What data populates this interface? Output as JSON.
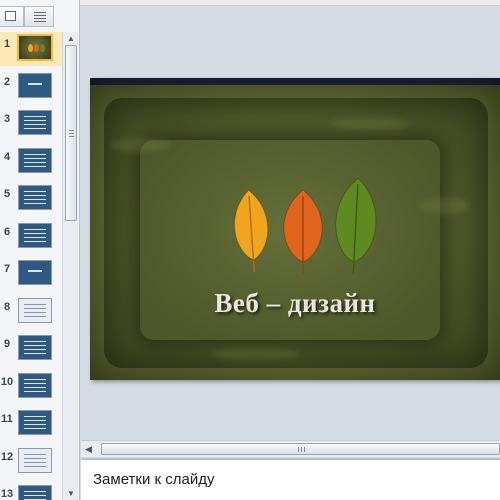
{
  "slide_panel": {
    "tabs": [
      {
        "name": "slides-tab",
        "icon": "slides-icon"
      },
      {
        "name": "outline-tab",
        "icon": "outline-icon"
      }
    ],
    "close_label": "×",
    "thumbnails": [
      {
        "number": "1",
        "selected": true,
        "style": "leaf"
      },
      {
        "number": "2",
        "selected": false,
        "style": "title-blue"
      },
      {
        "number": "3",
        "selected": false,
        "style": "text-blue"
      },
      {
        "number": "4",
        "selected": false,
        "style": "text-blue"
      },
      {
        "number": "5",
        "selected": false,
        "style": "text-blue"
      },
      {
        "number": "6",
        "selected": false,
        "style": "text-blue"
      },
      {
        "number": "7",
        "selected": false,
        "style": "title-blue"
      },
      {
        "number": "8",
        "selected": false,
        "style": "light"
      },
      {
        "number": "9",
        "selected": false,
        "style": "text-blue"
      },
      {
        "number": "10",
        "selected": false,
        "style": "text-blue"
      },
      {
        "number": "11",
        "selected": false,
        "style": "text-blue"
      },
      {
        "number": "12",
        "selected": false,
        "style": "light"
      },
      {
        "number": "13",
        "selected": false,
        "style": "text-blue"
      }
    ]
  },
  "slide": {
    "title": "Веб – дизайн",
    "leaf_colors": [
      "#f0a51e",
      "#e0651c",
      "#5e8a22"
    ],
    "background_color": "#525b2c"
  },
  "notes": {
    "placeholder": "Заметки к слайду"
  },
  "colors": {
    "selection": "#f5b93a",
    "thumbnail_blue": "#2f5985"
  }
}
